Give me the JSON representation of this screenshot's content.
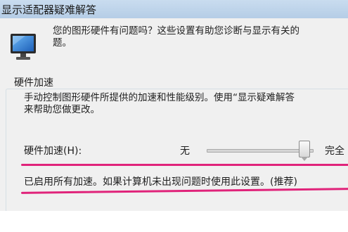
{
  "window": {
    "title": "显示适配器疑难解答"
  },
  "intro_text": "您的图形硬件有问题吗？这些设置有助您诊断与显示有关的问题。",
  "intro_lines": [
    "您的图形硬件有问题吗？这些设置有助您诊断与显示有关的",
    "题。"
  ],
  "icons": {
    "dialog_icon": "monitor-icon"
  },
  "hardware_acceleration": {
    "group_title": "硬件加速",
    "description_lines": [
      "手动控制图形硬件所提供的加速和性能级别。使用“显示疑难解答",
      "来帮助您做更改。"
    ],
    "slider_label": "硬件加速(H):",
    "slider_min_label": "无",
    "slider_max_label": "完全",
    "slider_level": 1.0,
    "status_text": "已启用所有加速。如果计算机未出现问题时使用此设置。(推荐)"
  },
  "colors": {
    "highlight_underline": "#e0237a",
    "title_bar": "#c9dcef"
  }
}
